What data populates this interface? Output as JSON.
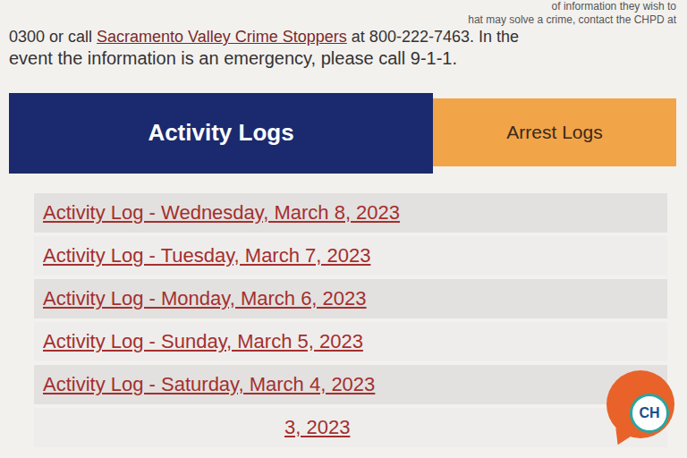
{
  "intro": {
    "line1": "of information they wish to",
    "line2": "hat may solve a crime, contact the CHPD at",
    "line3_before": "0300 or call ",
    "line3_link": "Sacramento Valley Crime Stoppers",
    "line3_after": " at 800-222-7463. In the",
    "line4": "event the information is an emergency, please call 9-1-1."
  },
  "tabs": [
    {
      "label": "Activity Logs",
      "selected": true,
      "color": "#1b2a6e"
    },
    {
      "label": "Arrest Logs",
      "selected": false,
      "color": "#f2a449"
    }
  ],
  "logs": [
    "Activity Log - Wednesday, March 8, 2023",
    "Activity Log - Tuesday, March 7, 2023",
    "Activity Log - Monday, March 6, 2023",
    "Activity Log - Sunday, March 5, 2023",
    "Activity Log - Saturday, March 4, 2023",
    "3, 2023"
  ],
  "chat_widget": {
    "logo": "CH"
  }
}
